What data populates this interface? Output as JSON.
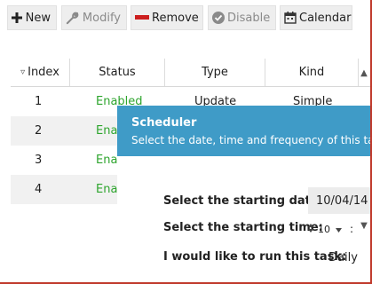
{
  "toolbar": {
    "new_label": "New",
    "modify_label": "Modify",
    "remove_label": "Remove",
    "disable_label": "Disable",
    "calendar_label": "Calendar",
    "icons": {
      "new": "plus-icon",
      "modify": "wrench-icon",
      "remove": "minus-icon",
      "disable": "check-circle-icon",
      "calendar": "calendar-icon"
    },
    "colors": {
      "remove": "#cc1f1f",
      "disabled_text": "#8a8a8a"
    }
  },
  "table": {
    "headers": [
      "Index",
      "Status",
      "Type",
      "Kind"
    ],
    "sort_indicator": "▿",
    "rows": [
      {
        "index": "1",
        "status": "Enabled",
        "type": "Update",
        "kind": "Simple"
      },
      {
        "index": "2",
        "status": "Ena"
      },
      {
        "index": "3",
        "status": "Ena"
      },
      {
        "index": "4",
        "status": "Ena"
      }
    ],
    "colors": {
      "enabled": "#2ea52e",
      "alt_row": "#f1f1f1"
    }
  },
  "scheduler": {
    "title": "Scheduler",
    "description": "Select the date, time and frequency of this ta",
    "banner_color": "#3f9bc7",
    "start_date_label": "Select the starting date:",
    "start_date_value": "10/04/14",
    "start_time_label": "Select the starting time:",
    "start_time_hour": "10",
    "run_label": "I would like to run this task:",
    "frequency_value": "Daily"
  }
}
